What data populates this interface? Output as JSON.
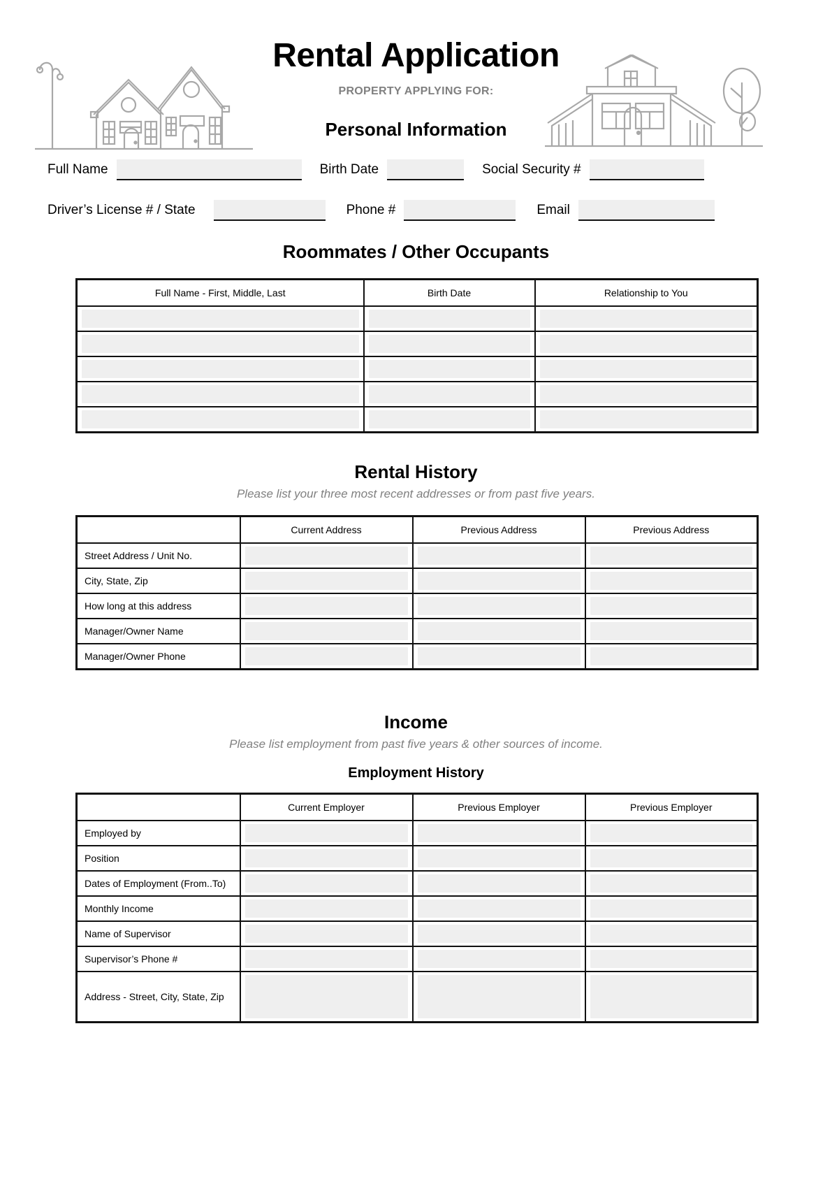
{
  "document": {
    "title": "Rental Application",
    "subtitle": "PROPERTY APPLYING FOR:"
  },
  "personal_information": {
    "heading": "Personal Information",
    "fields": [
      {
        "label": "Full Name",
        "value": "",
        "placeholder": ""
      },
      {
        "label": "Birth Date",
        "value": "",
        "placeholder": ""
      },
      {
        "label": "Social Security #",
        "value": "",
        "placeholder": ""
      },
      {
        "label": "Driver’s License # / State",
        "value": "",
        "placeholder": ""
      },
      {
        "label": "Phone #",
        "value": "",
        "placeholder": ""
      },
      {
        "label": "Email",
        "value": "",
        "placeholder": ""
      }
    ]
  },
  "roommates": {
    "heading": "Roommates / Other Occupants",
    "columns": [
      "Full Name - First, Middle, Last",
      "Birth Date",
      "Relationship to You"
    ],
    "row_count": 5,
    "rows": [
      [
        "",
        "",
        ""
      ],
      [
        "",
        "",
        ""
      ],
      [
        "",
        "",
        ""
      ],
      [
        "",
        "",
        ""
      ],
      [
        "",
        "",
        ""
      ]
    ]
  },
  "rental_history": {
    "heading": "Rental History",
    "note": "Please list your three most recent addresses or from past five years.",
    "columns": [
      "",
      "Current Address",
      "Previous Address",
      "Previous Address"
    ],
    "row_labels": [
      "Street Address / Unit No.",
      "City, State, Zip",
      "How long at this address",
      "Manager/Owner Name",
      "Manager/Owner Phone"
    ],
    "values": [
      [
        "",
        "",
        ""
      ],
      [
        "",
        "",
        ""
      ],
      [
        "",
        "",
        ""
      ],
      [
        "",
        "",
        ""
      ],
      [
        "",
        "",
        ""
      ]
    ]
  },
  "income": {
    "heading": "Income",
    "note": "Please list employment from past five years & other sources of income.",
    "employment_history": {
      "heading": "Employment History",
      "columns": [
        "",
        "Current Employer",
        "Previous Employer",
        "Previous Employer"
      ],
      "row_labels": [
        "Employed by",
        "Position",
        "Dates of Employment (From..To)",
        "Monthly Income",
        "Name of Supervisor",
        "Supervisor’s Phone #",
        "Address - Street, City, State, Zip"
      ],
      "values": [
        [
          "",
          "",
          ""
        ],
        [
          "",
          "",
          ""
        ],
        [
          "",
          "",
          ""
        ],
        [
          "",
          "",
          ""
        ],
        [
          "",
          "",
          ""
        ],
        [
          "",
          "",
          ""
        ],
        [
          "",
          "",
          ""
        ]
      ]
    }
  },
  "colors": {
    "input_fill": "#efefef",
    "border": "#111111",
    "muted_text": "#808080",
    "illustration": "#a8a8a8"
  },
  "illustrations": {
    "left": "two-gabled-houses-with-streetlamp",
    "right": "colonial-house-with-dormer-and-tree"
  }
}
